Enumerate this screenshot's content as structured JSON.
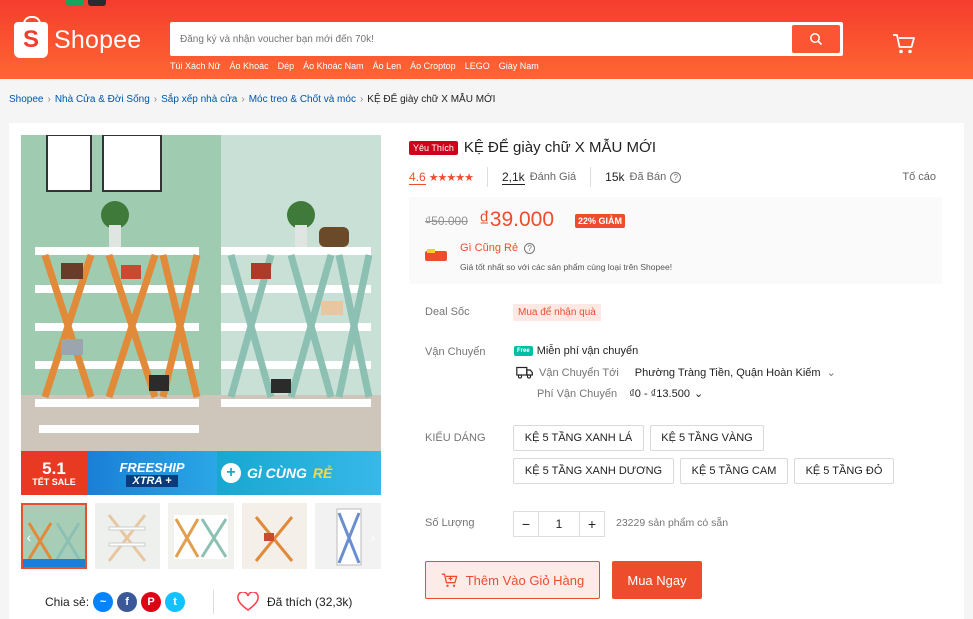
{
  "colors": {
    "brand": "#ee4d2d",
    "header_top": "#f53d2d",
    "header_bottom": "#ff6633",
    "link": "#0055aa",
    "free_ship": "#00bfa5",
    "star": "#ee4d2d"
  },
  "header": {
    "logo_text": "Shopee",
    "search_placeholder": "Đăng ký và nhận voucher bạn mới đến 70k!",
    "hotwords": [
      "Túi Xách Nữ",
      "Áo Khoác",
      "Dép",
      "Áo Khoác Nam",
      "Áo Len",
      "Áo Croptop",
      "LEGO",
      "Giày Nam"
    ],
    "icons": [
      "search-icon",
      "cart-icon"
    ]
  },
  "breadcrumb": {
    "items": [
      "Shopee",
      "Nhà Cửa & Đời Sống",
      "Sắp xếp nhà cửa",
      "Móc treo & Chốt và móc"
    ],
    "current": "KỆ ĐỂ giày chữ X MẪU MỚI"
  },
  "gallery": {
    "banner": {
      "date": "5.1",
      "sale": "TẾT SALE",
      "freeship": "FREESHIP",
      "xtra": "XTRA +",
      "gcr": "GÌ CÙNG",
      "gcr_accent": "RẺ"
    },
    "thumbnail_count": 5,
    "share_label": "Chia sẻ:",
    "social": [
      "messenger-icon",
      "facebook-icon",
      "pinterest-icon",
      "twitter-icon"
    ],
    "like_label": "Đã thích (32,3k)"
  },
  "product": {
    "badge": "Yêu Thích",
    "title": "KỆ ĐỂ giày chữ X MẪU MỚI",
    "rating": "4.6",
    "rating_value": 4.6,
    "reviews_count": "2,1k",
    "reviews_label": "Đánh Giá",
    "sold_count": "15k",
    "sold_label": "Đã Bán",
    "report_label": "Tố cáo",
    "old_price": "₫50.000",
    "price": "₫39.000",
    "discount": "22% GIẢM",
    "gcr_title": "Gì Cũng Rẻ",
    "gcr_desc": "Giá tốt nhất so với các sản phẩm cùng loại trên Shopee!",
    "deal_label": "Deal Sốc",
    "deal_value": "Mua để nhận quà",
    "shipping_label": "Vận Chuyển",
    "free_badge": "Free",
    "free_shipping": "Miễn phí vận chuyển",
    "ship_to_label": "Vận Chuyển Tới",
    "ship_to_value": "Phường Tràng Tiền, Quận Hoàn Kiếm",
    "ship_fee_label": "Phí Vận Chuyển",
    "ship_fee_value": "₫0 - ₫13.500",
    "variation_label": "KIỂU DÁNG",
    "variations": [
      "KỆ 5 TẦNG XANH LÁ",
      "KỆ 5 TẦNG VÀNG",
      "KỆ 5 TẦNG XANH DƯƠNG",
      "KỆ 5 TẦNG CAM",
      "KỆ 5 TẦNG ĐỎ"
    ],
    "quantity_label": "Số Lượng",
    "quantity": "1",
    "minus": "−",
    "plus": "+",
    "stock": "23229 sản phẩm có sẵn",
    "add_to_cart": "Thêm Vào Giỏ Hàng",
    "buy_now": "Mua Ngay"
  }
}
